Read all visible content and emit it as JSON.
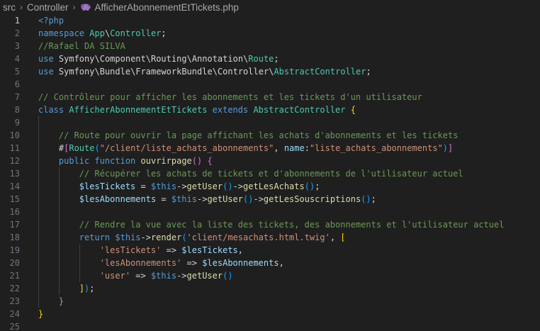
{
  "breadcrumb": {
    "items": [
      "src",
      "Controller",
      "AfficherAbonnementEtTickets.php"
    ],
    "separator": ">",
    "file_icon": "php-elephant-icon"
  },
  "editor": {
    "current_line": 1,
    "lines": [
      {
        "n": "1",
        "indent": 0,
        "tokens": [
          {
            "t": "<?php",
            "c": "php"
          }
        ]
      },
      {
        "n": "2",
        "indent": 0,
        "tokens": [
          {
            "t": "namespace ",
            "c": "kw"
          },
          {
            "t": "App",
            "c": "class"
          },
          {
            "t": "\\",
            "c": "plain"
          },
          {
            "t": "Controller",
            "c": "class"
          },
          {
            "t": ";",
            "c": "plain"
          }
        ]
      },
      {
        "n": "3",
        "indent": 0,
        "tokens": [
          {
            "t": "//Rafael DA SILVA",
            "c": "comment"
          }
        ]
      },
      {
        "n": "4",
        "indent": 0,
        "tokens": [
          {
            "t": "use ",
            "c": "kw"
          },
          {
            "t": "Symfony",
            "c": "plain"
          },
          {
            "t": "\\",
            "c": "plain"
          },
          {
            "t": "Component",
            "c": "plain"
          },
          {
            "t": "\\",
            "c": "plain"
          },
          {
            "t": "Routing",
            "c": "plain"
          },
          {
            "t": "\\",
            "c": "plain"
          },
          {
            "t": "Annotation",
            "c": "plain"
          },
          {
            "t": "\\",
            "c": "plain"
          },
          {
            "t": "Route",
            "c": "class"
          },
          {
            "t": ";",
            "c": "plain"
          }
        ]
      },
      {
        "n": "5",
        "indent": 0,
        "tokens": [
          {
            "t": "use ",
            "c": "kw"
          },
          {
            "t": "Symfony",
            "c": "plain"
          },
          {
            "t": "\\",
            "c": "plain"
          },
          {
            "t": "Bundle",
            "c": "plain"
          },
          {
            "t": "\\",
            "c": "plain"
          },
          {
            "t": "FrameworkBundle",
            "c": "plain"
          },
          {
            "t": "\\",
            "c": "plain"
          },
          {
            "t": "Controller",
            "c": "plain"
          },
          {
            "t": "\\",
            "c": "plain"
          },
          {
            "t": "AbstractController",
            "c": "class"
          },
          {
            "t": ";",
            "c": "plain"
          }
        ]
      },
      {
        "n": "6",
        "indent": 0,
        "tokens": []
      },
      {
        "n": "7",
        "indent": 0,
        "tokens": [
          {
            "t": "// Contrôleur pour afficher les abonnements et les tickets d'un utilisateur",
            "c": "comment"
          }
        ]
      },
      {
        "n": "8",
        "indent": 0,
        "tokens": [
          {
            "t": "class ",
            "c": "kw"
          },
          {
            "t": "AfficherAbonnementEtTickets ",
            "c": "class"
          },
          {
            "t": "extends ",
            "c": "kw"
          },
          {
            "t": "AbstractController ",
            "c": "class"
          },
          {
            "t": "{",
            "c": "brace1"
          }
        ]
      },
      {
        "n": "9",
        "indent": 1,
        "tokens": []
      },
      {
        "n": "10",
        "indent": 1,
        "tokens": [
          {
            "t": "    // Route pour ouvrir la page affichant les achats d'abonnements et les tickets",
            "c": "comment"
          }
        ]
      },
      {
        "n": "11",
        "indent": 1,
        "tokens": [
          {
            "t": "    #",
            "c": "plain"
          },
          {
            "t": "[",
            "c": "brace2"
          },
          {
            "t": "Route",
            "c": "class"
          },
          {
            "t": "(",
            "c": "brace3"
          },
          {
            "t": "\"/client/liste_achats_abonnements\"",
            "c": "str"
          },
          {
            "t": ", ",
            "c": "plain"
          },
          {
            "t": "name",
            "c": "var"
          },
          {
            "t": ":",
            "c": "plain"
          },
          {
            "t": "\"liste_achats_abonnements\"",
            "c": "str"
          },
          {
            "t": ")",
            "c": "brace3"
          },
          {
            "t": "]",
            "c": "brace2"
          }
        ]
      },
      {
        "n": "12",
        "indent": 1,
        "tokens": [
          {
            "t": "    public ",
            "c": "kw"
          },
          {
            "t": "function ",
            "c": "kw"
          },
          {
            "t": "ouvrirpage",
            "c": "func"
          },
          {
            "t": "() ",
            "c": "brace2"
          },
          {
            "t": "{",
            "c": "brace2"
          }
        ]
      },
      {
        "n": "13",
        "indent": 2,
        "tokens": [
          {
            "t": "        // Récupérer les achats de tickets et d'abonnements de l'utilisateur actuel",
            "c": "comment"
          }
        ]
      },
      {
        "n": "14",
        "indent": 2,
        "tokens": [
          {
            "t": "        $lesTickets",
            "c": "var"
          },
          {
            "t": " = ",
            "c": "plain"
          },
          {
            "t": "$this",
            "c": "this"
          },
          {
            "t": "->",
            "c": "plain"
          },
          {
            "t": "getUser",
            "c": "func"
          },
          {
            "t": "()",
            "c": "brace3"
          },
          {
            "t": "->",
            "c": "plain"
          },
          {
            "t": "getLesAchats",
            "c": "func"
          },
          {
            "t": "()",
            "c": "brace3"
          },
          {
            "t": ";",
            "c": "plain"
          }
        ]
      },
      {
        "n": "15",
        "indent": 2,
        "tokens": [
          {
            "t": "        $lesAbonnements",
            "c": "var"
          },
          {
            "t": " = ",
            "c": "plain"
          },
          {
            "t": "$this",
            "c": "this"
          },
          {
            "t": "->",
            "c": "plain"
          },
          {
            "t": "getUser",
            "c": "func"
          },
          {
            "t": "()",
            "c": "brace3"
          },
          {
            "t": "->",
            "c": "plain"
          },
          {
            "t": "getLesSouscriptions",
            "c": "func"
          },
          {
            "t": "()",
            "c": "brace3"
          },
          {
            "t": ";",
            "c": "plain"
          }
        ]
      },
      {
        "n": "16",
        "indent": 2,
        "tokens": []
      },
      {
        "n": "17",
        "indent": 2,
        "tokens": [
          {
            "t": "        // Rendre la vue avec la liste des tickets, des abonnements et l'utilisateur actuel",
            "c": "comment"
          }
        ]
      },
      {
        "n": "18",
        "indent": 2,
        "tokens": [
          {
            "t": "        return ",
            "c": "kw"
          },
          {
            "t": "$this",
            "c": "this"
          },
          {
            "t": "->",
            "c": "plain"
          },
          {
            "t": "render",
            "c": "func"
          },
          {
            "t": "(",
            "c": "brace3"
          },
          {
            "t": "'client/mesachats.html.twig'",
            "c": "str"
          },
          {
            "t": ", ",
            "c": "plain"
          },
          {
            "t": "[",
            "c": "brace1"
          }
        ]
      },
      {
        "n": "19",
        "indent": 3,
        "tokens": [
          {
            "t": "            'lesTickets'",
            "c": "str"
          },
          {
            "t": " => ",
            "c": "plain"
          },
          {
            "t": "$lesTickets",
            "c": "var"
          },
          {
            "t": ",",
            "c": "plain"
          }
        ]
      },
      {
        "n": "20",
        "indent": 3,
        "tokens": [
          {
            "t": "            'lesAbonnements'",
            "c": "str"
          },
          {
            "t": " => ",
            "c": "plain"
          },
          {
            "t": "$lesAbonnements",
            "c": "var"
          },
          {
            "t": ",",
            "c": "plain"
          }
        ]
      },
      {
        "n": "21",
        "indent": 3,
        "tokens": [
          {
            "t": "            'user'",
            "c": "str"
          },
          {
            "t": " => ",
            "c": "plain"
          },
          {
            "t": "$this",
            "c": "this"
          },
          {
            "t": "->",
            "c": "plain"
          },
          {
            "t": "getUser",
            "c": "func"
          },
          {
            "t": "()",
            "c": "brace3"
          }
        ]
      },
      {
        "n": "22",
        "indent": 2,
        "tokens": [
          {
            "t": "        ]",
            "c": "brace1"
          },
          {
            "t": ")",
            "c": "brace3"
          },
          {
            "t": ";",
            "c": "plain"
          }
        ]
      },
      {
        "n": "23",
        "indent": 1,
        "tokens": [
          {
            "t": "    }",
            "c": "brace2"
          }
        ]
      },
      {
        "n": "24",
        "indent": 0,
        "tokens": [
          {
            "t": "}",
            "c": "brace1"
          }
        ]
      },
      {
        "n": "25",
        "indent": 0,
        "tokens": []
      }
    ]
  }
}
